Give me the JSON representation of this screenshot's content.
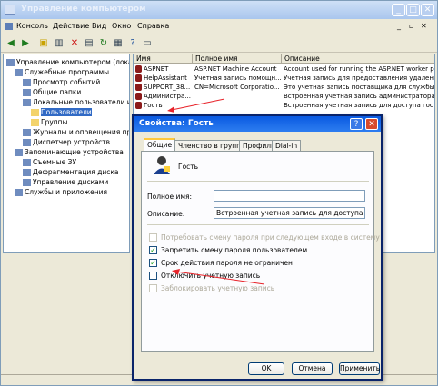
{
  "window": {
    "title": "Управление компьютером"
  },
  "menu": [
    "Консоль",
    "Действие",
    "Вид",
    "Окно",
    "Справка"
  ],
  "tree": [
    {
      "label": "Управление компьютером (локальный)",
      "level": 0
    },
    {
      "label": "Служебные программы",
      "level": 1
    },
    {
      "label": "Просмотр событий",
      "level": 2
    },
    {
      "label": "Общие папки",
      "level": 2
    },
    {
      "label": "Локальные пользователи и группы",
      "level": 2
    },
    {
      "label": "Пользователи",
      "level": 3,
      "selected": true
    },
    {
      "label": "Группы",
      "level": 3
    },
    {
      "label": "Журналы и оповещения производительности",
      "level": 2
    },
    {
      "label": "Диспетчер устройств",
      "level": 2
    },
    {
      "label": "Запоминающие устройства",
      "level": 1
    },
    {
      "label": "Съемные ЗУ",
      "level": 2
    },
    {
      "label": "Дефрагментация диска",
      "level": 2
    },
    {
      "label": "Управление дисками",
      "level": 2
    },
    {
      "label": "Службы и приложения",
      "level": 1
    }
  ],
  "list": {
    "headers": [
      "Имя",
      "Полное имя",
      "Описание"
    ],
    "rows": [
      [
        "ASPNET",
        "ASP.NET Machine Account",
        "Account used for running the ASP.NET worker process"
      ],
      [
        "HelpAssistant",
        "Учетная запись помощн...",
        "Учетная запись для предоставления удаленной помощи"
      ],
      [
        "SUPPORT_38...",
        "CN=Microsoft Corporatio...",
        "Это учетная запись поставщика для службы справки"
      ],
      [
        "Администра...",
        "",
        "Встроенная учетная запись администратора компьютера"
      ],
      [
        "Гость",
        "",
        "Встроенная учетная запись для доступа гостей к компьютеру"
      ]
    ]
  },
  "dialog": {
    "title": "Свойства: Гость",
    "help": "?",
    "close": "✕",
    "tabs": [
      "Общие",
      "Членство в группах",
      "Профиль",
      "Dial-in"
    ],
    "user_name": "Гость",
    "full_name_label": "Полное имя:",
    "full_name_value": "",
    "description_label": "Описание:",
    "description_value": "Встроенная учетная запись для доступа гостей",
    "checkboxes": [
      {
        "label": "Потребовать смену пароля при следующем входе в систему",
        "checked": false,
        "disabled": true
      },
      {
        "label": "Запретить смену пароля пользователем",
        "checked": true,
        "disabled": false
      },
      {
        "label": "Срок действия пароля не ограничен",
        "checked": true,
        "disabled": false
      },
      {
        "label": "Отключить учетную запись",
        "checked": false,
        "disabled": false
      },
      {
        "label": "Заблокировать учетную запись",
        "checked": false,
        "disabled": true
      }
    ],
    "buttons": {
      "ok": "OK",
      "cancel": "Отмена",
      "apply": "Применить"
    }
  },
  "colors": {
    "accent": "#0a5ae1",
    "arrow": "#e8232a"
  }
}
